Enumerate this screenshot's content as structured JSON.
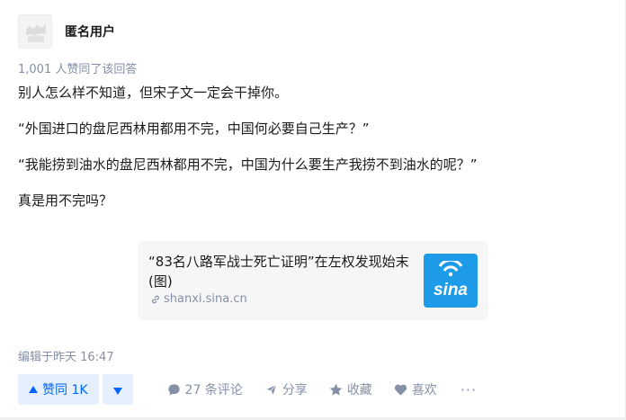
{
  "author": {
    "name": "匿名用户",
    "avatar_icon": "anonymous-avatar-icon"
  },
  "upvote_summary": "1,001 人赞同了该回答",
  "content": {
    "paragraphs": [
      "别人怎么样不知道，但宋子文一定会干掉你。",
      "“外国进口的盘尼西林用都用不完，中国何必要自己生产？”",
      "“我能捞到油水的盘尼西林都用不完，中国为什么要生产我捞不到油水的呢？”",
      "真是用不完吗？"
    ]
  },
  "link_card": {
    "title": "“83名八路军战士死亡证明”在左权发现始末(图)",
    "domain": "shanxi.sina.cn",
    "thumbnail_icon": "sina-logo-icon",
    "thumbnail_color": "#1e9be8"
  },
  "edited_time": "编辑于昨天 16:47",
  "actions": {
    "upvote": "赞同 1K",
    "comments": "27 条评论",
    "share": "分享",
    "favorite": "收藏",
    "like": "喜欢",
    "more": "···"
  },
  "colors": {
    "accent": "#0066ff",
    "vote_bg": "#e5effe",
    "meta_text": "#8590a6"
  }
}
